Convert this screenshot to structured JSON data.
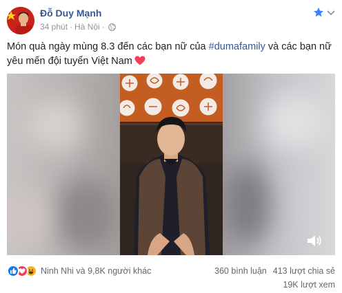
{
  "post": {
    "author": "Đỗ Duy Mạnh",
    "time": "34 phút",
    "separator": "·",
    "location": "Hà Nội",
    "text_before": "Món quà ngày mùng 8.3 đến các bạn nữ của ",
    "hashtag": "#dumafamily",
    "text_after": " và các bạn nữ yêu mến đội tuyển Việt Nam",
    "icons": [
      "globe-icon",
      "star-icon",
      "chevron-down-icon",
      "heart-icon",
      "volume-icon"
    ]
  },
  "footer": {
    "reactions": [
      "like",
      "love",
      "haha"
    ],
    "reactors": "Ninh Nhi và 9,8K người khác",
    "comments": "360 bình luận",
    "shares": "413 lượt chia sẻ",
    "views": "19K lượt xem"
  },
  "colors": {
    "link": "#365899",
    "meta": "#90949c",
    "heart": "#f33e58"
  }
}
